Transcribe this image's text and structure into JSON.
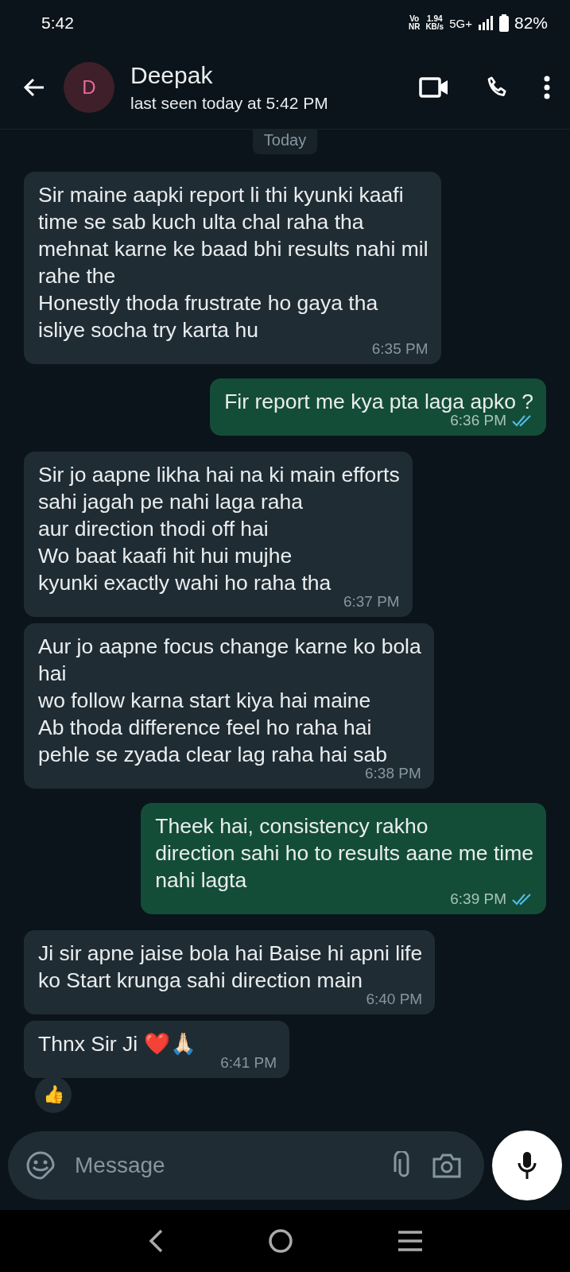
{
  "status_bar": {
    "time": "5:42",
    "volte_top": "Vo",
    "volte_bottom": "NR",
    "speed_value": "1.94",
    "speed_unit": "KB/s",
    "network": "5G+",
    "battery": "82%"
  },
  "header": {
    "avatar_letter": "D",
    "name": "Deepak",
    "last_seen": "last seen today at 5:42 PM"
  },
  "date_chip": "Today",
  "messages": [
    {
      "outgoing": false,
      "lines": [
        "Sir maine aapki report li thi kyunki kaafi",
        "time se sab kuch ulta chal raha tha",
        "mehnat karne ke baad bhi results nahi mil",
        "rahe the",
        "Honestly thoda frustrate ho gaya tha",
        "isliye socha try karta hu"
      ],
      "time": "6:35 PM"
    },
    {
      "outgoing": true,
      "read": true,
      "lines": [
        "Fir report me kya pta laga apko ?"
      ],
      "time": "6:36 PM"
    },
    {
      "outgoing": false,
      "lines": [
        "Sir jo aapne likha hai na ki main efforts",
        "sahi jagah pe nahi laga raha",
        "aur direction thodi off hai",
        "Wo baat kaafi hit hui mujhe",
        "kyunki exactly wahi ho raha tha"
      ],
      "time": "6:37 PM"
    },
    {
      "outgoing": false,
      "lines": [
        "Aur jo aapne focus change karne ko bola",
        "hai",
        "wo follow karna start kiya hai maine",
        "Ab thoda difference feel ho raha hai",
        "pehle se zyada clear lag raha hai sab"
      ],
      "time": "6:38 PM"
    },
    {
      "outgoing": true,
      "read": true,
      "lines": [
        "Theek hai, consistency rakho",
        "direction sahi ho to results aane me time",
        "nahi lagta"
      ],
      "time": "6:39 PM"
    },
    {
      "outgoing": false,
      "lines": [
        "Ji sir apne jaise bola hai Baise hi apni life",
        "ko Start krunga sahi direction main"
      ],
      "time": "6:40 PM"
    },
    {
      "outgoing": false,
      "lines": [
        "Thnx Sir Ji ❤️🙏🏻"
      ],
      "time": "6:41 PM",
      "reaction": "👍"
    }
  ],
  "composer": {
    "placeholder": "Message"
  }
}
